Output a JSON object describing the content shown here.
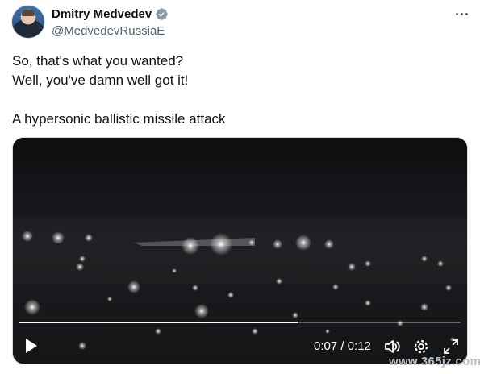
{
  "author": {
    "name": "Dmitry Medvedev",
    "handle": "@MedvedevRussiaE",
    "verified": true,
    "verified_color": "#8b98a5"
  },
  "tweet": {
    "lines": [
      "So, that's what you wanted?",
      "Well, you've damn well got it!",
      "A hypersonic ballistic missile attack"
    ]
  },
  "video": {
    "current_time": "0:07",
    "duration": "0:12",
    "time_display": "0:07 / 0:12",
    "progress_fraction": 0.63
  },
  "icons": {
    "more": "more-options-icon",
    "play": "play-icon",
    "volume": "volume-icon",
    "settings": "settings-icon",
    "fullscreen": "fullscreen-icon",
    "verified": "verified-badge-icon"
  },
  "watermark": "www.365jz.com",
  "colors": {
    "text": "#0f1419",
    "secondary": "#536471",
    "video_bg": "#0f1012"
  }
}
